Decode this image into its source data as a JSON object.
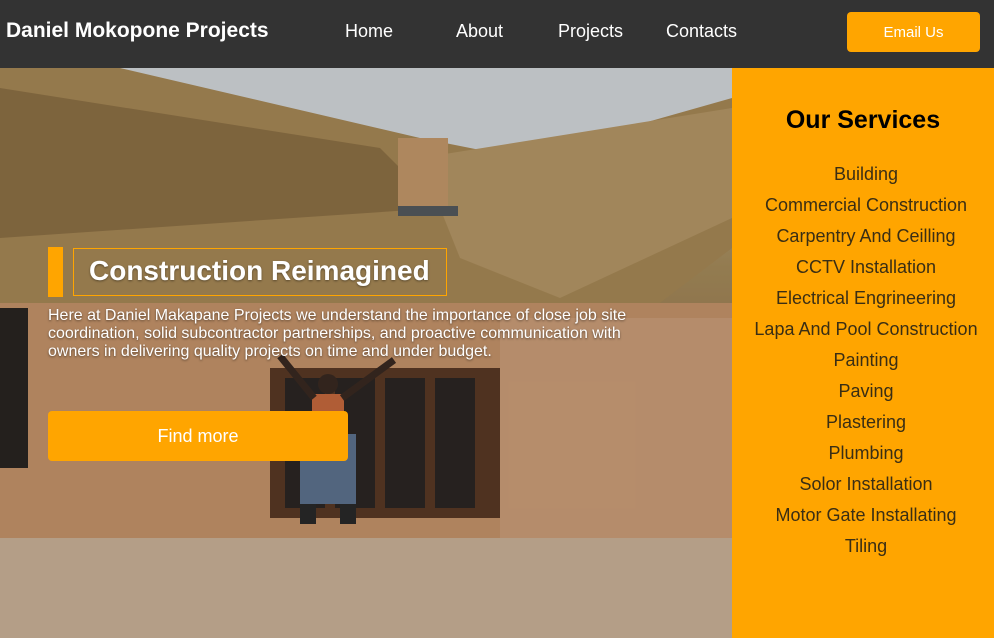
{
  "nav": {
    "brand": "Daniel Mokopone Projects",
    "links": [
      "Home",
      "About",
      "Projects",
      "Contacts"
    ],
    "email_button": "Email Us"
  },
  "hero": {
    "title": "Construction Reimagined",
    "text": "Here at Daniel Makapane Projects we understand the importance of close job site coordination, solid subcontractor partnerships, and proactive communication with owners in delivering quality projects on time and under budget.",
    "button": "Find more"
  },
  "services": {
    "title": "Our Services",
    "items": [
      "Building",
      "Commercial Construction",
      "Carpentry And Ceilling",
      "CCTV Installation",
      "Electrical Engrineering",
      "Lapa And Pool Construction",
      "Painting",
      "Paving",
      "Plastering",
      "Plumbing",
      "Solor Installation",
      "Motor Gate Installating",
      "Tiling"
    ]
  },
  "colors": {
    "accent": "#ffa500",
    "navbar": "#333333"
  }
}
